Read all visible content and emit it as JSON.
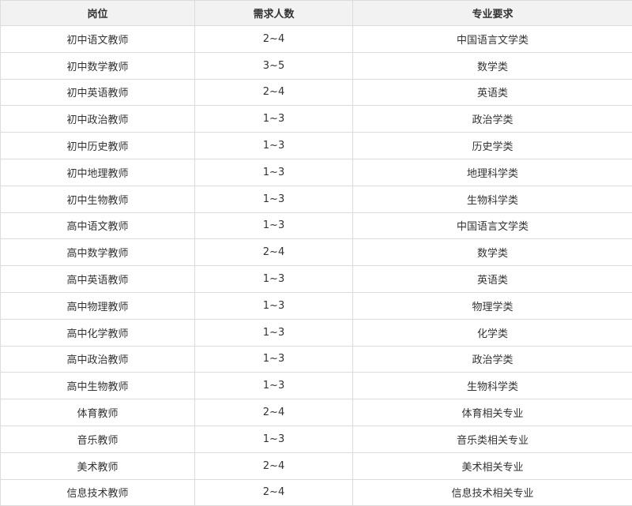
{
  "table": {
    "headers": [
      "岗位",
      "需求人数",
      "专业要求"
    ],
    "rows": [
      [
        "初中语文教师",
        "2~4",
        "中国语言文学类"
      ],
      [
        "初中数学教师",
        "3~5",
        "数学类"
      ],
      [
        "初中英语教师",
        "2~4",
        "英语类"
      ],
      [
        "初中政治教师",
        "1~3",
        "政治学类"
      ],
      [
        "初中历史教师",
        "1~3",
        "历史学类"
      ],
      [
        "初中地理教师",
        "1~3",
        "地理科学类"
      ],
      [
        "初中生物教师",
        "1~3",
        "生物科学类"
      ],
      [
        "高中语文教师",
        "1~3",
        "中国语言文学类"
      ],
      [
        "高中数学教师",
        "2~4",
        "数学类"
      ],
      [
        "高中英语教师",
        "1~3",
        "英语类"
      ],
      [
        "高中物理教师",
        "1~3",
        "物理学类"
      ],
      [
        "高中化学教师",
        "1~3",
        "化学类"
      ],
      [
        "高中政治教师",
        "1~3",
        "政治学类"
      ],
      [
        "高中生物教师",
        "1~3",
        "生物科学类"
      ],
      [
        "体育教师",
        "2~4",
        "体育相关专业"
      ],
      [
        "音乐教师",
        "1~3",
        "音乐类相关专业"
      ],
      [
        "美术教师",
        "2~4",
        "美术相关专业"
      ],
      [
        "信息技术教师",
        "2~4",
        "信息技术相关专业"
      ]
    ]
  }
}
